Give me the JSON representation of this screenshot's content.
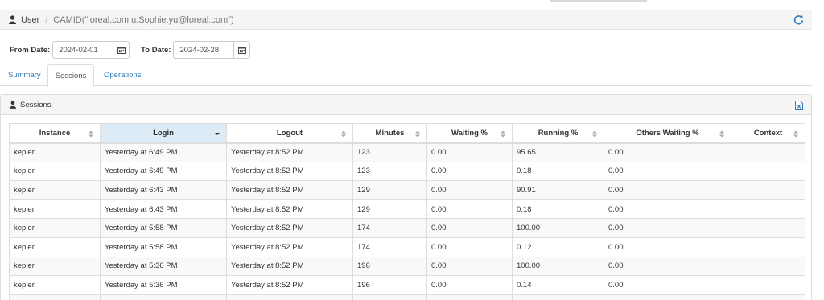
{
  "header": {
    "title": "User",
    "separator": "/",
    "camid": "CAMID(\"loreal.com:u:Sophie.yu@loreal.com\")",
    "icon": "user-icon",
    "refresh_icon": "refresh-icon"
  },
  "filters": {
    "from_label": "From Date:",
    "from_value": "2024-02-01",
    "to_label": "To Date:",
    "to_value": "2024-02-28",
    "calendar_icon": "calendar-icon"
  },
  "tabs": [
    {
      "label": "Summary",
      "active": false
    },
    {
      "label": "Sessions",
      "active": true
    },
    {
      "label": "Operations",
      "active": false
    }
  ],
  "panel": {
    "title": "Sessions",
    "icon": "user-icon",
    "export_icon": "excel-export-icon"
  },
  "table": {
    "columns": [
      "Instance",
      "Login",
      "Logout",
      "Minutes",
      "Waiting %",
      "Running %",
      "Others Waiting %",
      "Context"
    ],
    "sorted_column": "Login",
    "rows": [
      [
        "kepler",
        "Yesterday at 6:49 PM",
        "Yesterday at 8:52 PM",
        "123",
        "0.00",
        "95.65",
        "0.00",
        ""
      ],
      [
        "kepler",
        "Yesterday at 6:49 PM",
        "Yesterday at 8:52 PM",
        "123",
        "0.00",
        "0.18",
        "0.00",
        ""
      ],
      [
        "kepler",
        "Yesterday at 6:43 PM",
        "Yesterday at 8:52 PM",
        "129",
        "0.00",
        "90.91",
        "0.00",
        ""
      ],
      [
        "kepler",
        "Yesterday at 6:43 PM",
        "Yesterday at 8:52 PM",
        "129",
        "0.00",
        "0.18",
        "0.00",
        ""
      ],
      [
        "kepler",
        "Yesterday at 5:58 PM",
        "Yesterday at 8:52 PM",
        "174",
        "0.00",
        "100.00",
        "0.00",
        ""
      ],
      [
        "kepler",
        "Yesterday at 5:58 PM",
        "Yesterday at 8:52 PM",
        "174",
        "0.00",
        "0.12",
        "0.00",
        ""
      ],
      [
        "kepler",
        "Yesterday at 5:36 PM",
        "Yesterday at 8:52 PM",
        "196",
        "0.00",
        "100.00",
        "0.00",
        ""
      ],
      [
        "kepler",
        "Yesterday at 5:36 PM",
        "Yesterday at 8:52 PM",
        "196",
        "0.00",
        "0.14",
        "0.00",
        ""
      ],
      [
        "",
        "",
        "",
        "",
        "",
        "",
        "",
        ""
      ]
    ]
  },
  "colors": {
    "link": "#337ab7",
    "sorted_header": "#dcebf5",
    "border": "#dddddd"
  }
}
